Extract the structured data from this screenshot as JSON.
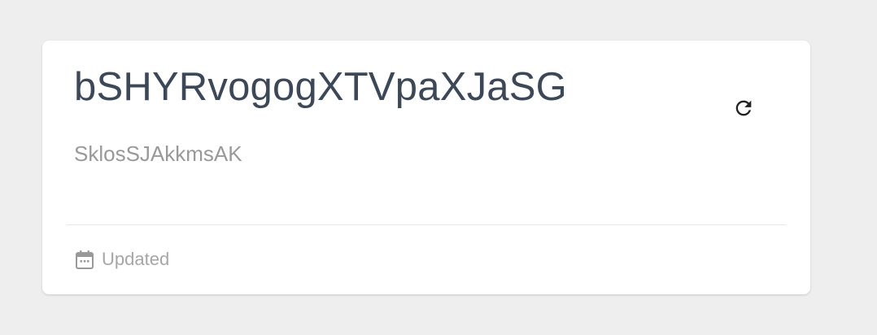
{
  "card": {
    "title": "bSHYRvogogXTVpaXJaSG",
    "subtitle": "SklosSJAkkmsAK",
    "refresh_icon": "refresh-icon",
    "footer": {
      "icon": "calendar-icon",
      "text": "Updated"
    }
  },
  "colors": {
    "page_background": "#eeeeee",
    "card_background": "#ffffff",
    "title": "#3c4858",
    "muted_text": "#999999",
    "icon": "#222222"
  }
}
